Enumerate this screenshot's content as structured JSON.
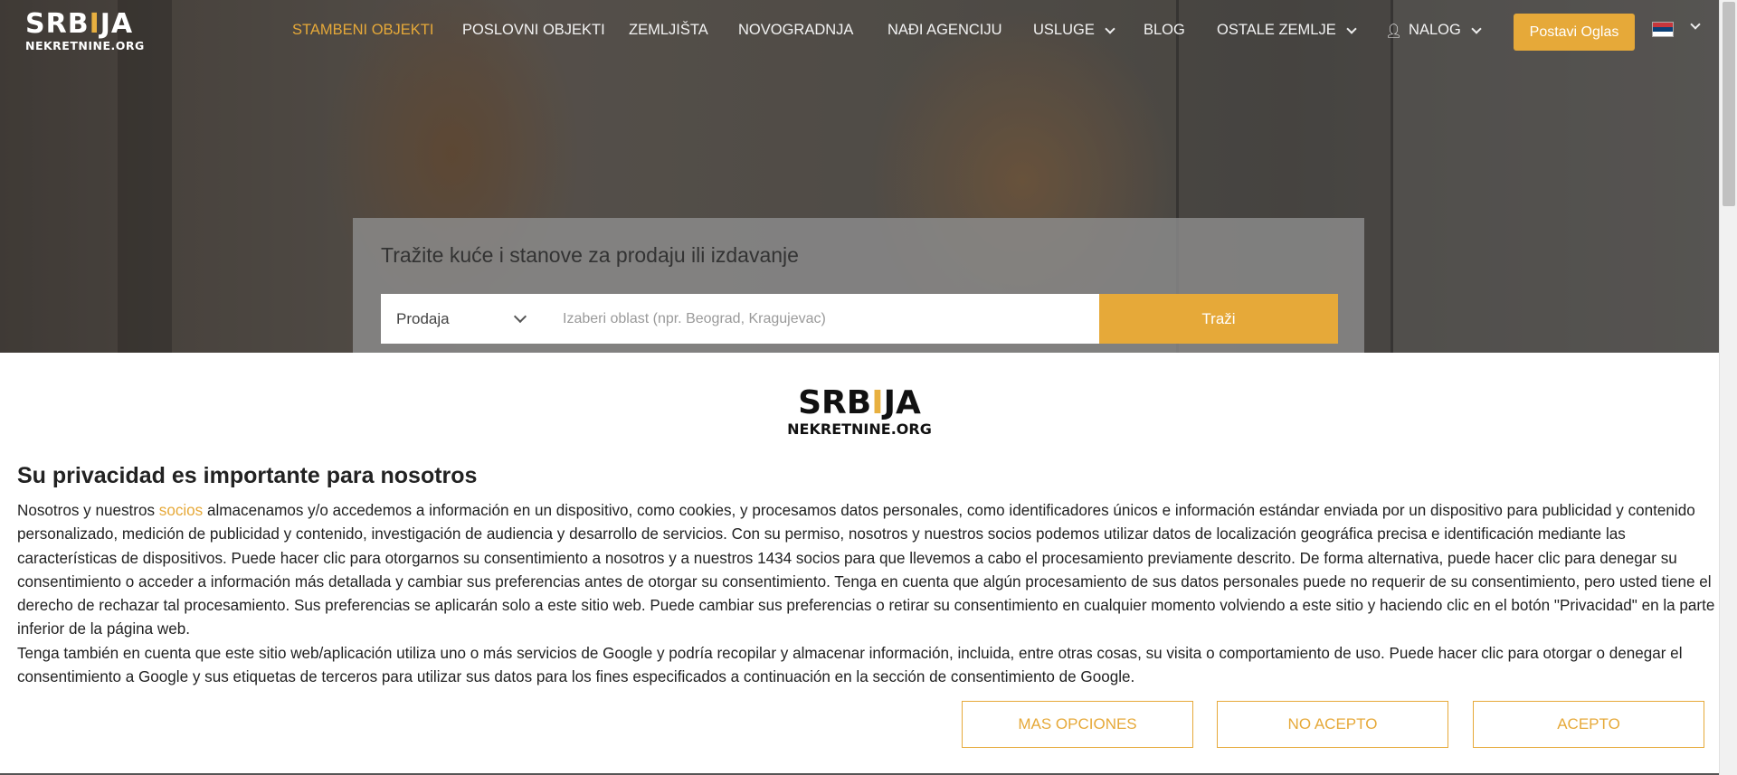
{
  "logo": {
    "main_pre": "SRB",
    "main_key": "I",
    "main_post": "JA",
    "sub": "NEKRETNINE.ORG"
  },
  "nav": {
    "items": [
      {
        "label": "STAMBENI OBJEKTI",
        "active": true
      },
      {
        "label": "POSLOVNI OBJEKTI"
      },
      {
        "label": "ZEMLJIŠTA"
      },
      {
        "label": "NOVOGRADNJA"
      },
      {
        "label": "NAĐI AGENCIJU"
      },
      {
        "label": "USLUGE",
        "dropdown": true
      },
      {
        "label": "BLOG"
      },
      {
        "label": "OSTALE ZEMLJE",
        "dropdown": true
      },
      {
        "label": "NALOG",
        "dropdown": true,
        "icon": "user-icon"
      }
    ],
    "post_ad_label": "Postavi Oglas",
    "language_flag": "serbia-flag-icon"
  },
  "search": {
    "title": "Tražite kuće i stanove za prodaju ili izdavanje",
    "deal_type": "Prodaja",
    "area_placeholder": "Izaberi oblast (npr. Beograd, Kragujevac)",
    "search_label": "Traži"
  },
  "consent": {
    "heading": "Su privacidad es importante para nosotros",
    "p1_before_link": "Nosotros y nuestros ",
    "partners_link": "socios",
    "p1_after_link": " almacenamos y/o accedemos a información en un dispositivo, como cookies, y procesamos datos personales, como identificadores únicos e información estándar enviada por un dispositivo para publicidad y contenido personalizado, medición de publicidad y contenido, investigación de audiencia y desarrollo de servicios. Con su permiso, nosotros y nuestros socios podemos utilizar datos de localización geográfica precisa e identificación mediante las características de dispositivos. Puede hacer clic para otorgarnos su consentimiento a nosotros y a nuestros 1434 socios para que llevemos a cabo el procesamiento previamente descrito. De forma alternativa, puede hacer clic para denegar su consentimiento o acceder a información más detallada y cambiar sus preferencias antes de otorgar su consentimiento. Tenga en cuenta que algún procesamiento de sus datos personales puede no requerir de su consentimiento, pero usted tiene el derecho de rechazar tal procesamiento. Sus preferencias se aplicarán solo a este sitio web. Puede cambiar sus preferencias o retirar su consentimiento en cualquier momento volviendo a este sitio y haciendo clic en el botón \"Privacidad\" en la parte inferior de la página web.",
    "p2": "Tenga también en cuenta que este sitio web/aplicación utiliza uno o más servicios de Google y podría recopilar y almacenar información, incluida, entre otras cosas, su visita o comportamiento de uso. Puede hacer clic para otorgar o denegar el consentimiento a Google y sus etiquetas de terceros para utilizar sus datos para los fines especificados a continuación en la sección de consentimiento de Google.",
    "buttons": {
      "more_options": "MAS OPCIONES",
      "reject": "NO ACEPTO",
      "accept": "ACEPTO"
    }
  },
  "colors": {
    "accent": "#e6a939",
    "text": "#222222",
    "flag_red": "#c6363c",
    "flag_blue": "#0c4076",
    "flag_white": "#ffffff"
  }
}
